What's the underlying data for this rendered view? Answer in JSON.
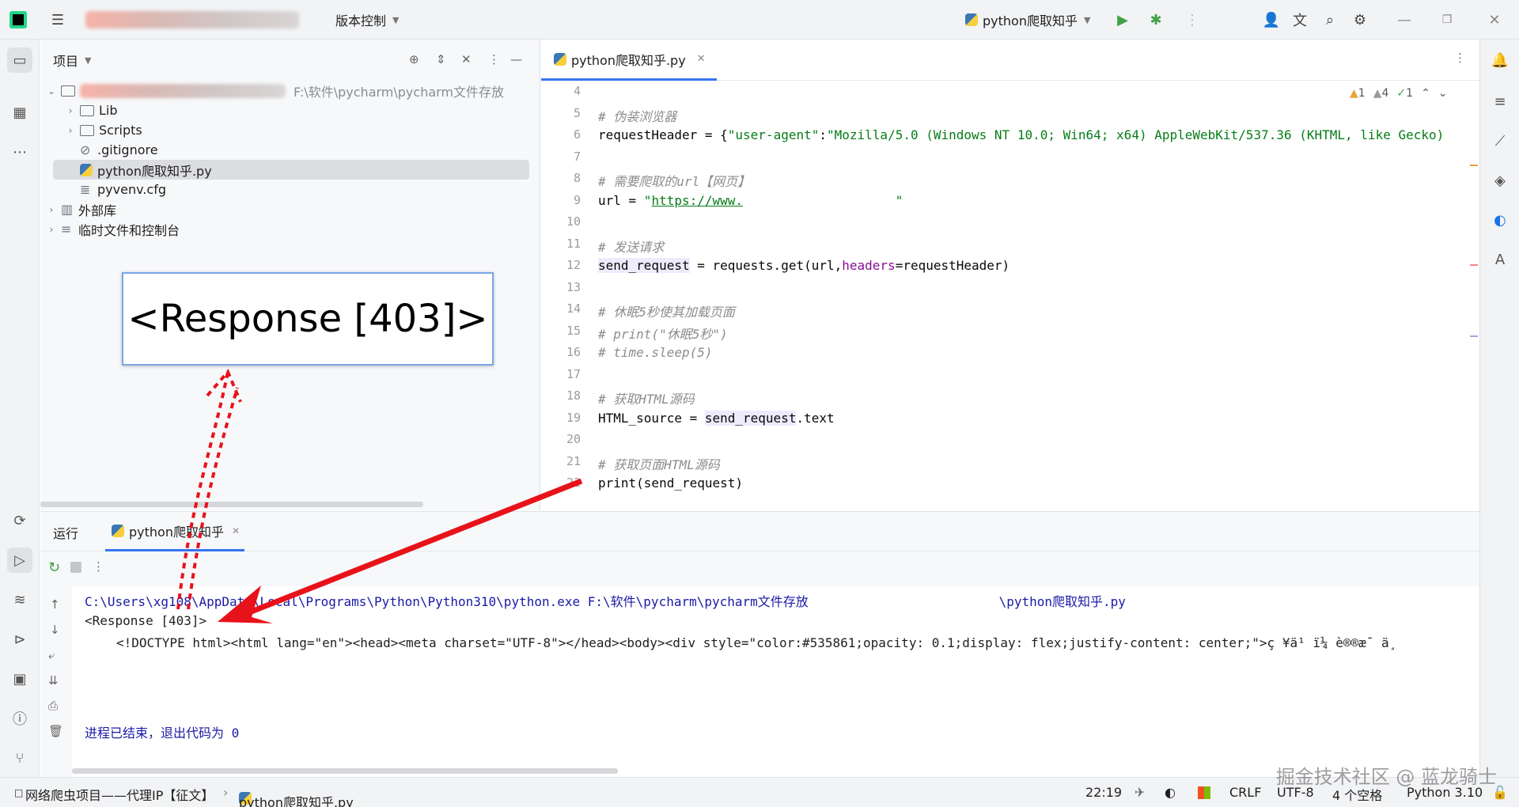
{
  "titlebar": {
    "project_name_blurred": "网络爬虫项目——代理IP【征文】",
    "vcs_menu": "版本控制",
    "run_config": "python爬取知乎"
  },
  "project_panel": {
    "title": "项目",
    "root_path": "F:\\软件\\pycharm\\pycharm文件存放",
    "items": [
      {
        "label": "Lib",
        "type": "folder"
      },
      {
        "label": "Scripts",
        "type": "folder"
      },
      {
        "label": ".gitignore",
        "type": "file"
      },
      {
        "label": "python爬取知乎.py",
        "type": "python",
        "selected": true
      },
      {
        "label": "pyvenv.cfg",
        "type": "file"
      },
      {
        "label": "外部库",
        "type": "library"
      },
      {
        "label": "临时文件和控制台",
        "type": "scratch"
      }
    ]
  },
  "editor": {
    "tab_label": "python爬取知乎.py",
    "inspections": {
      "warnings": "1",
      "weak_warnings": "4",
      "typos": "1"
    },
    "lines": [
      {
        "n": "4",
        "html": ""
      },
      {
        "n": "5",
        "html": "<span class='cm'># 伪装浏览器</span>"
      },
      {
        "n": "6",
        "html": "requestHeader = {<span class='str'>\"user-agent\"</span>:<span class='str'>\"Mozilla/5.0 (Windows NT 10.0; Win64; x64) AppleWebKit/537.36 (KHTML, like Gecko)</span>"
      },
      {
        "n": "7",
        "html": ""
      },
      {
        "n": "8",
        "html": "<span class='cm'># 需要爬取的url【网页】</span>"
      },
      {
        "n": "9",
        "html": "url = <span class='str'>\"<u>https://www.</u>                    \"</span>"
      },
      {
        "n": "10",
        "html": ""
      },
      {
        "n": "11",
        "html": "<span class='cm'># 发送请求</span>"
      },
      {
        "n": "12",
        "html": "<span class='hl'>send_request</span> = requests.get(url,<span class='kw'>headers</span>=requestHeader)"
      },
      {
        "n": "13",
        "html": ""
      },
      {
        "n": "14",
        "html": "<span class='cm'># 休眠5秒使其加载页面</span>"
      },
      {
        "n": "15",
        "html": "<span class='cm'># print(\"休眠5秒\")</span>"
      },
      {
        "n": "16",
        "html": "<span class='cm'># time.sleep(5)</span>"
      },
      {
        "n": "17",
        "html": ""
      },
      {
        "n": "18",
        "html": "<span class='cm'># 获取HTML源码</span>"
      },
      {
        "n": "19",
        "html": "HTML_source = <span class='hl'>send_request</span>.text"
      },
      {
        "n": "20",
        "html": ""
      },
      {
        "n": "21",
        "html": "<span class='cm'># 获取页面HTML源码</span>"
      },
      {
        "n": "22",
        "html": "print(send_request)"
      }
    ]
  },
  "run_panel": {
    "title": "运行",
    "tab_label": "python爬取知乎",
    "output": {
      "command": "C:\\Users\\xg108\\AppData\\Local\\Programs\\Python\\Python310\\python.exe F:\\软件\\pycharm\\pycharm文件存放                         \\python爬取知乎.py",
      "response": "<Response [403]>",
      "html": "<!DOCTYPE html><html lang=\"en\"><head><meta charset=\"UTF-8\"></head><body><div style=\"color:#535861;opacity: 0.1;display: flex;justify-content: center;\">ç ¥ä¹ ï¼ è®®æ¯ ä¸",
      "exit": "进程已结束，退出代码为 0"
    }
  },
  "callout": {
    "text": "<Response [403]>"
  },
  "statusbar": {
    "breadcrumb_project": "网络爬虫项目——代理IP【征文】",
    "breadcrumb_file": "python爬取知乎.py",
    "position": "22:19",
    "line_sep": "CRLF",
    "encoding": "UTF-8",
    "indent": "4 个空格",
    "interpreter": "Python 3.10"
  },
  "watermark": "掘金技术社区 @ 蓝龙骑士"
}
